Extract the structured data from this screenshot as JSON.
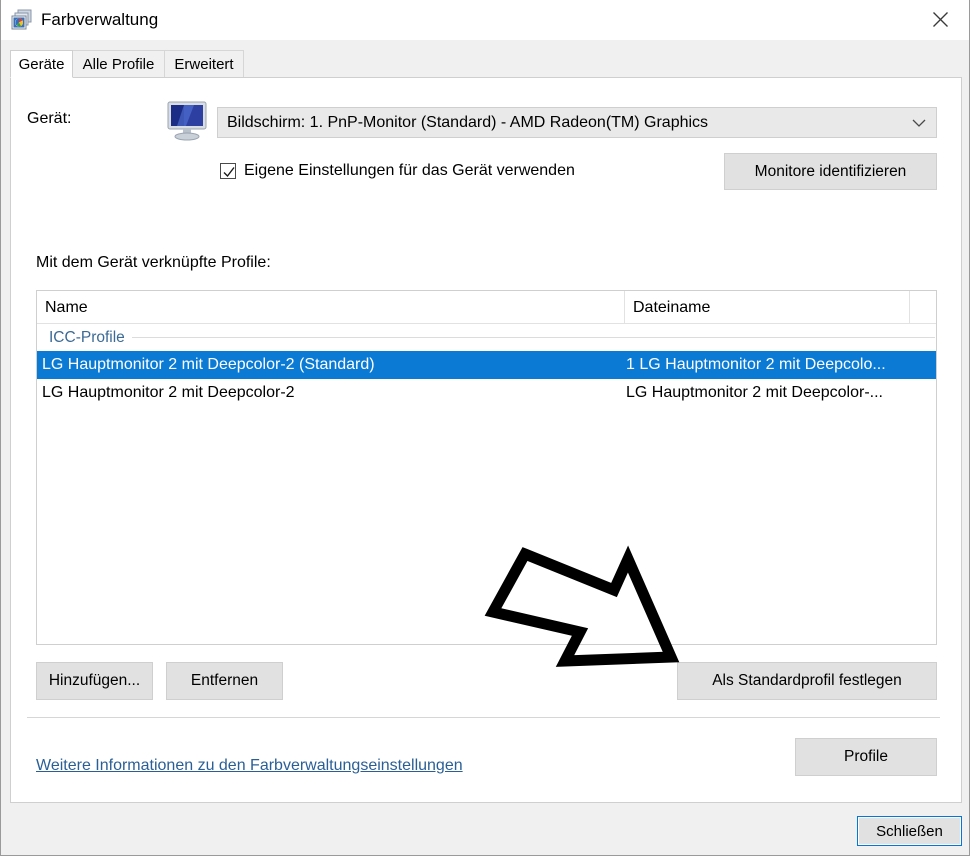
{
  "window": {
    "title": "Farbverwaltung",
    "icon": "color-management-icon",
    "close_label": "✕"
  },
  "tabs": [
    {
      "label": "Geräte",
      "active": true
    },
    {
      "label": "Alle Profile",
      "active": false
    },
    {
      "label": "Erweitert",
      "active": false
    }
  ],
  "device": {
    "label": "Gerät:",
    "icon": "monitor-icon",
    "selected": "Bildschirm: 1. PnP-Monitor (Standard) - AMD Radeon(TM) Graphics",
    "dropdown_icon": "chevron-down-icon",
    "use_settings_checkbox_label": "Eigene Einstellungen für das Gerät verwenden",
    "use_settings_checked": true,
    "identify_button": "Monitore identifizieren"
  },
  "profiles": {
    "section_label": "Mit dem Gerät verknüpfte Profile:",
    "columns": [
      "Name",
      "Dateiname",
      ""
    ],
    "group_label": "ICC-Profile",
    "rows": [
      {
        "name": "LG Hauptmonitor 2 mit Deepcolor-2 (Standard)",
        "filename": "1 LG Hauptmonitor 2 mit Deepcolo...",
        "selected": true
      },
      {
        "name": "LG Hauptmonitor 2 mit Deepcolor-2",
        "filename": "LG Hauptmonitor 2 mit Deepcolor-...",
        "selected": false
      }
    ],
    "add_button": "Hinzufügen...",
    "remove_button": "Entfernen",
    "set_default_button": "Als Standardprofil festlegen"
  },
  "footer": {
    "more_info_link": "Weitere Informationen zu den Farbverwaltungseinstellungen",
    "profiles_button": "Profile",
    "close_button": "Schließen"
  },
  "annotation": {
    "shape": "hand-drawn-arrow",
    "direction": "down-right",
    "color": "#000000"
  },
  "colors": {
    "selection_blue": "#0a7ad4",
    "link_blue": "#2a5f96",
    "group_header_blue": "#3a6a95",
    "button_face": "#e1e1e1",
    "window_bg": "#f0f0f0",
    "focus_border": "#0078d7"
  }
}
